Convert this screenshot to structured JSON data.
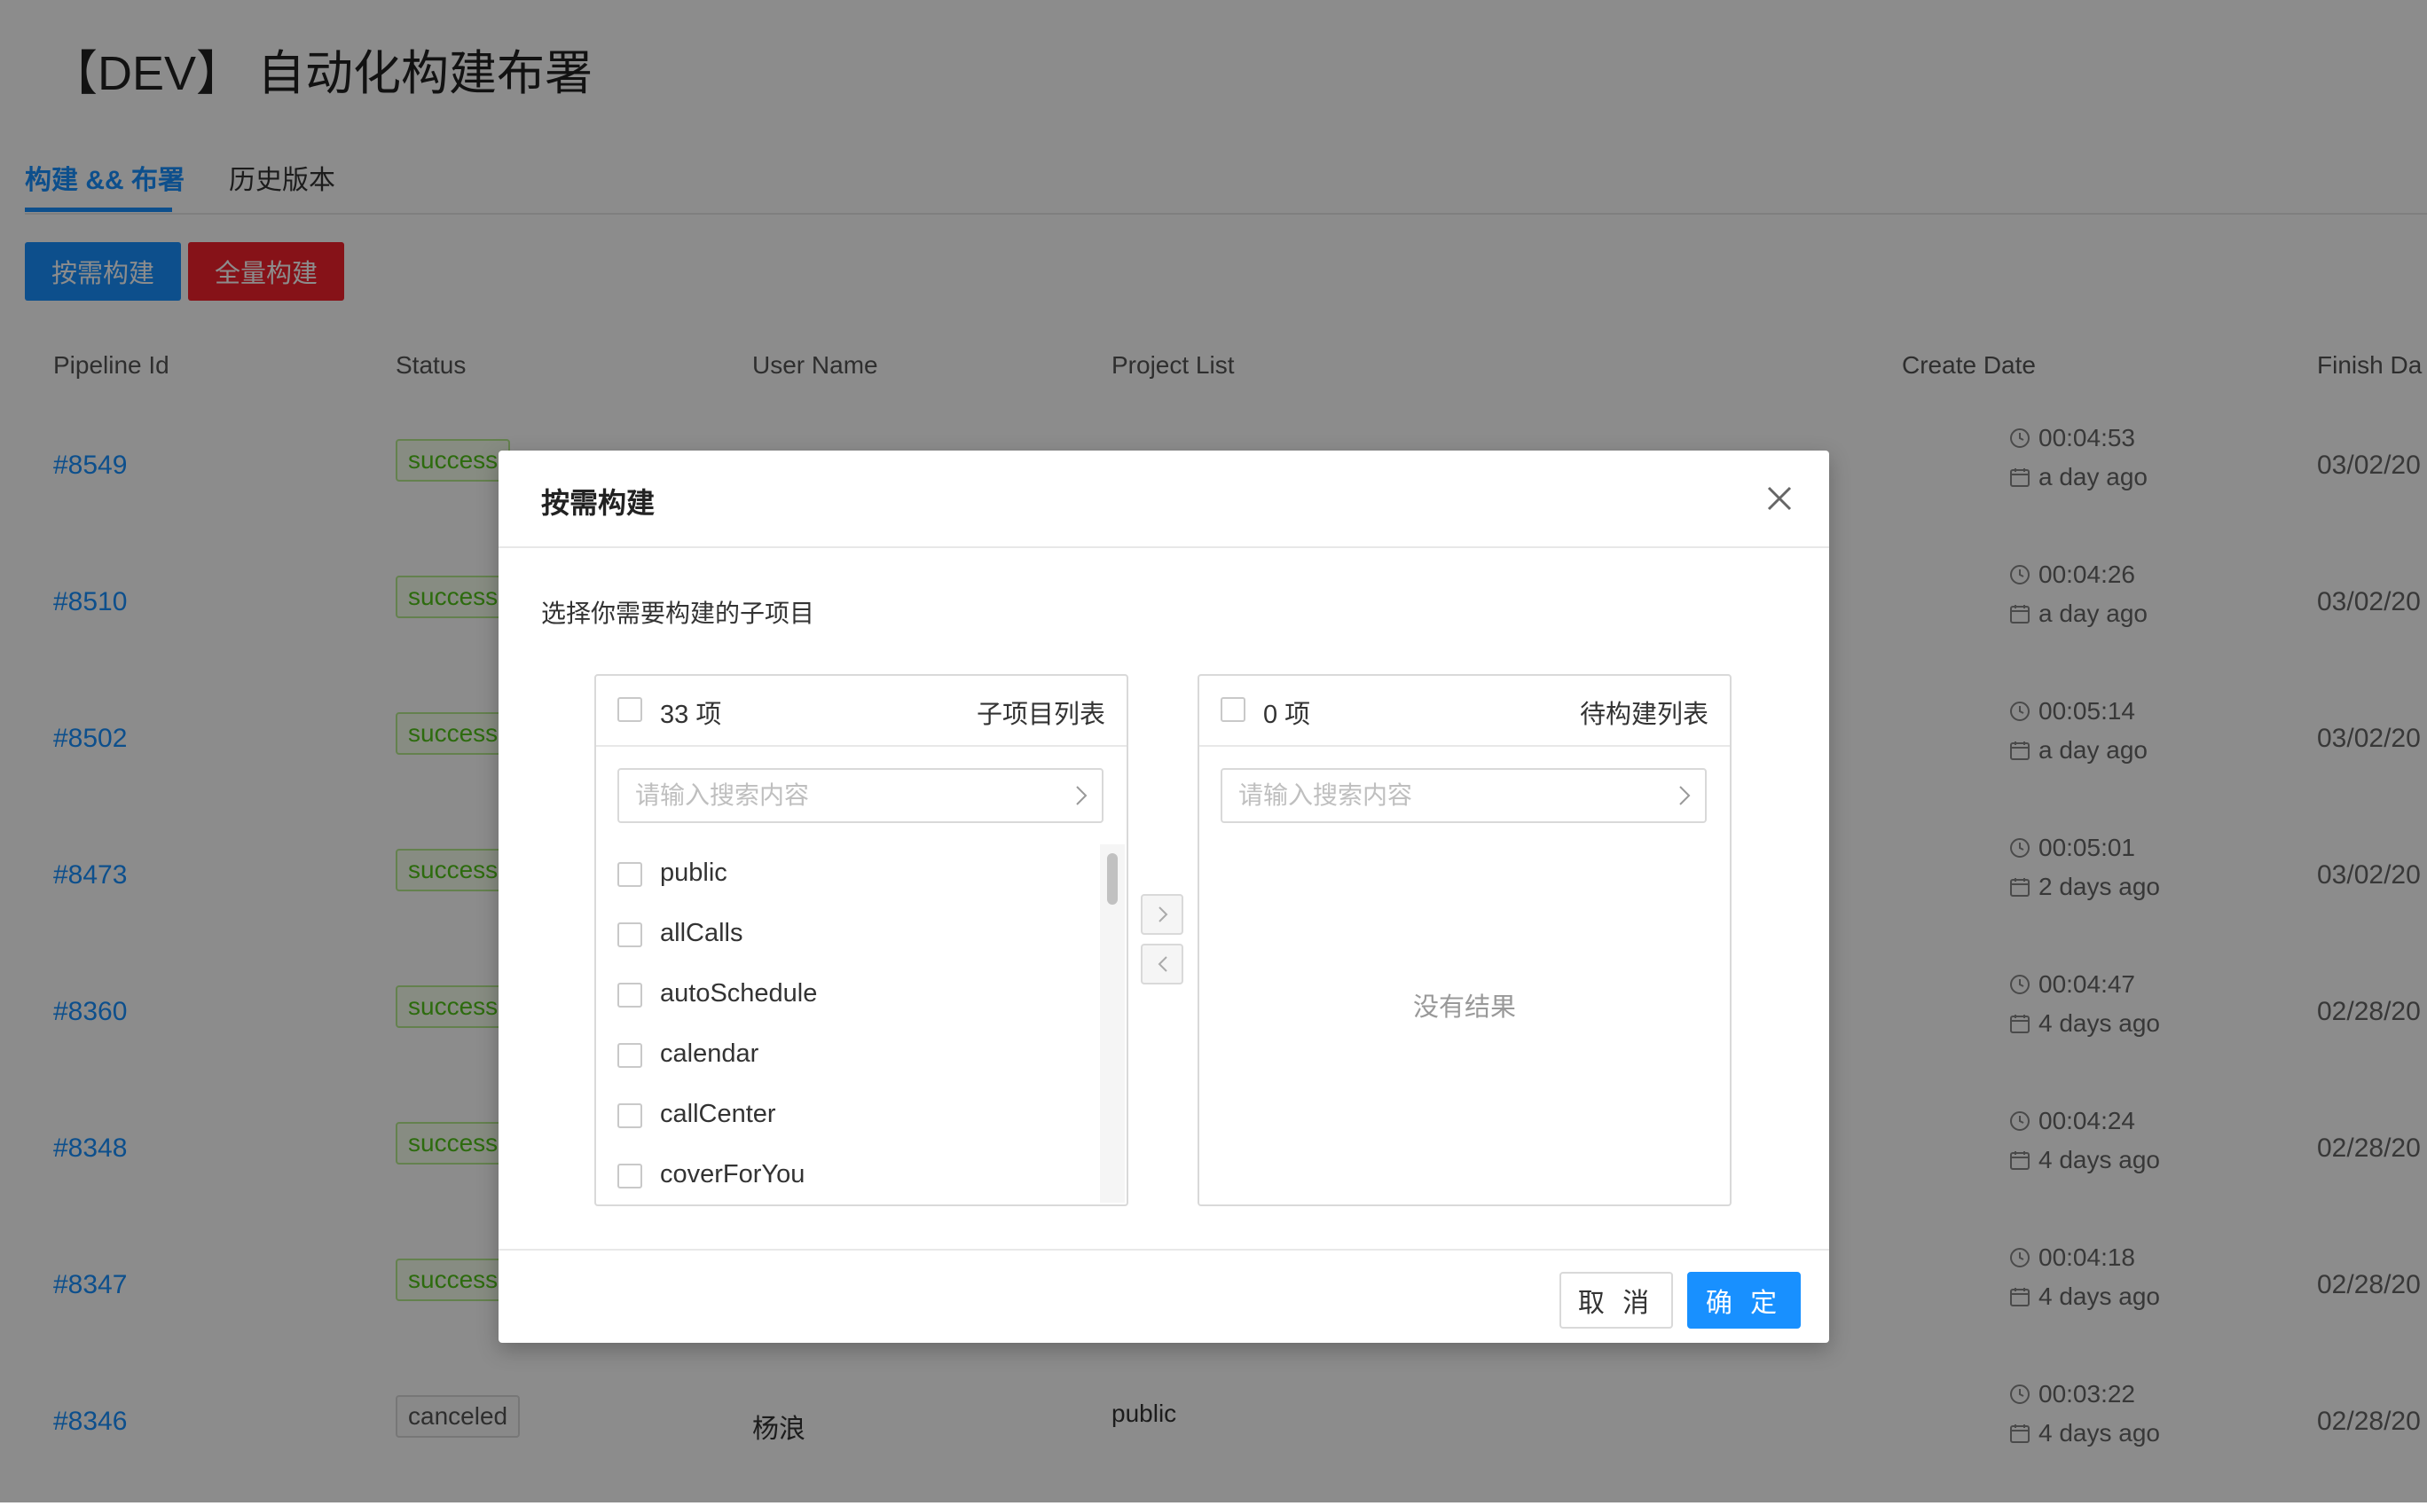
{
  "page": {
    "title": "【DEV】 自动化构建布署"
  },
  "tabs": [
    {
      "label": "构建 && 布署",
      "active": true
    },
    {
      "label": "历史版本",
      "active": false
    }
  ],
  "actions": {
    "on_demand": "按需构建",
    "full": "全量构建"
  },
  "colors": {
    "primary": "#1890ff",
    "danger": "#f5222d",
    "success": "#52c41a"
  },
  "table": {
    "headers": [
      "Pipeline Id",
      "Status",
      "User Name",
      "Project List",
      "Create Date",
      "Finish Da"
    ],
    "rows": [
      {
        "id": "#8549",
        "status": "success",
        "user": "",
        "project": "",
        "time": "00:04:53",
        "ago": "a day ago",
        "finish": "03/02/20"
      },
      {
        "id": "#8510",
        "status": "success",
        "user": "",
        "project": "",
        "time": "00:04:26",
        "ago": "a day ago",
        "finish": "03/02/20"
      },
      {
        "id": "#8502",
        "status": "success",
        "user": "",
        "project": "",
        "time": "00:05:14",
        "ago": "a day ago",
        "finish": "03/02/20"
      },
      {
        "id": "#8473",
        "status": "success",
        "user": "",
        "project": "",
        "time": "00:05:01",
        "ago": "2 days ago",
        "finish": "03/02/20"
      },
      {
        "id": "#8360",
        "status": "success",
        "user": "",
        "project": "",
        "time": "00:04:47",
        "ago": "4 days ago",
        "finish": "02/28/20"
      },
      {
        "id": "#8348",
        "status": "success",
        "user": "",
        "project": "",
        "time": "00:04:24",
        "ago": "4 days ago",
        "finish": "02/28/20"
      },
      {
        "id": "#8347",
        "status": "success",
        "user": "",
        "project": "",
        "time": "00:04:18",
        "ago": "4 days ago",
        "finish": "02/28/20"
      },
      {
        "id": "#8346",
        "status": "canceled",
        "user": "杨浪",
        "project": "public",
        "time": "00:03:22",
        "ago": "4 days ago",
        "finish": "02/28/20"
      }
    ]
  },
  "modal": {
    "title": "按需构建",
    "description": "选择你需要构建的子项目",
    "source": {
      "count": "33 项",
      "title": "子项目列表",
      "search_placeholder": "请输入搜索内容",
      "items": [
        "public",
        "allCalls",
        "autoSchedule",
        "calendar",
        "callCenter",
        "coverForYou"
      ]
    },
    "target": {
      "count": "0 项",
      "title": "待构建列表",
      "search_placeholder": "请输入搜索内容",
      "empty": "没有结果"
    },
    "cancel": "取 消",
    "ok": "确 定"
  }
}
